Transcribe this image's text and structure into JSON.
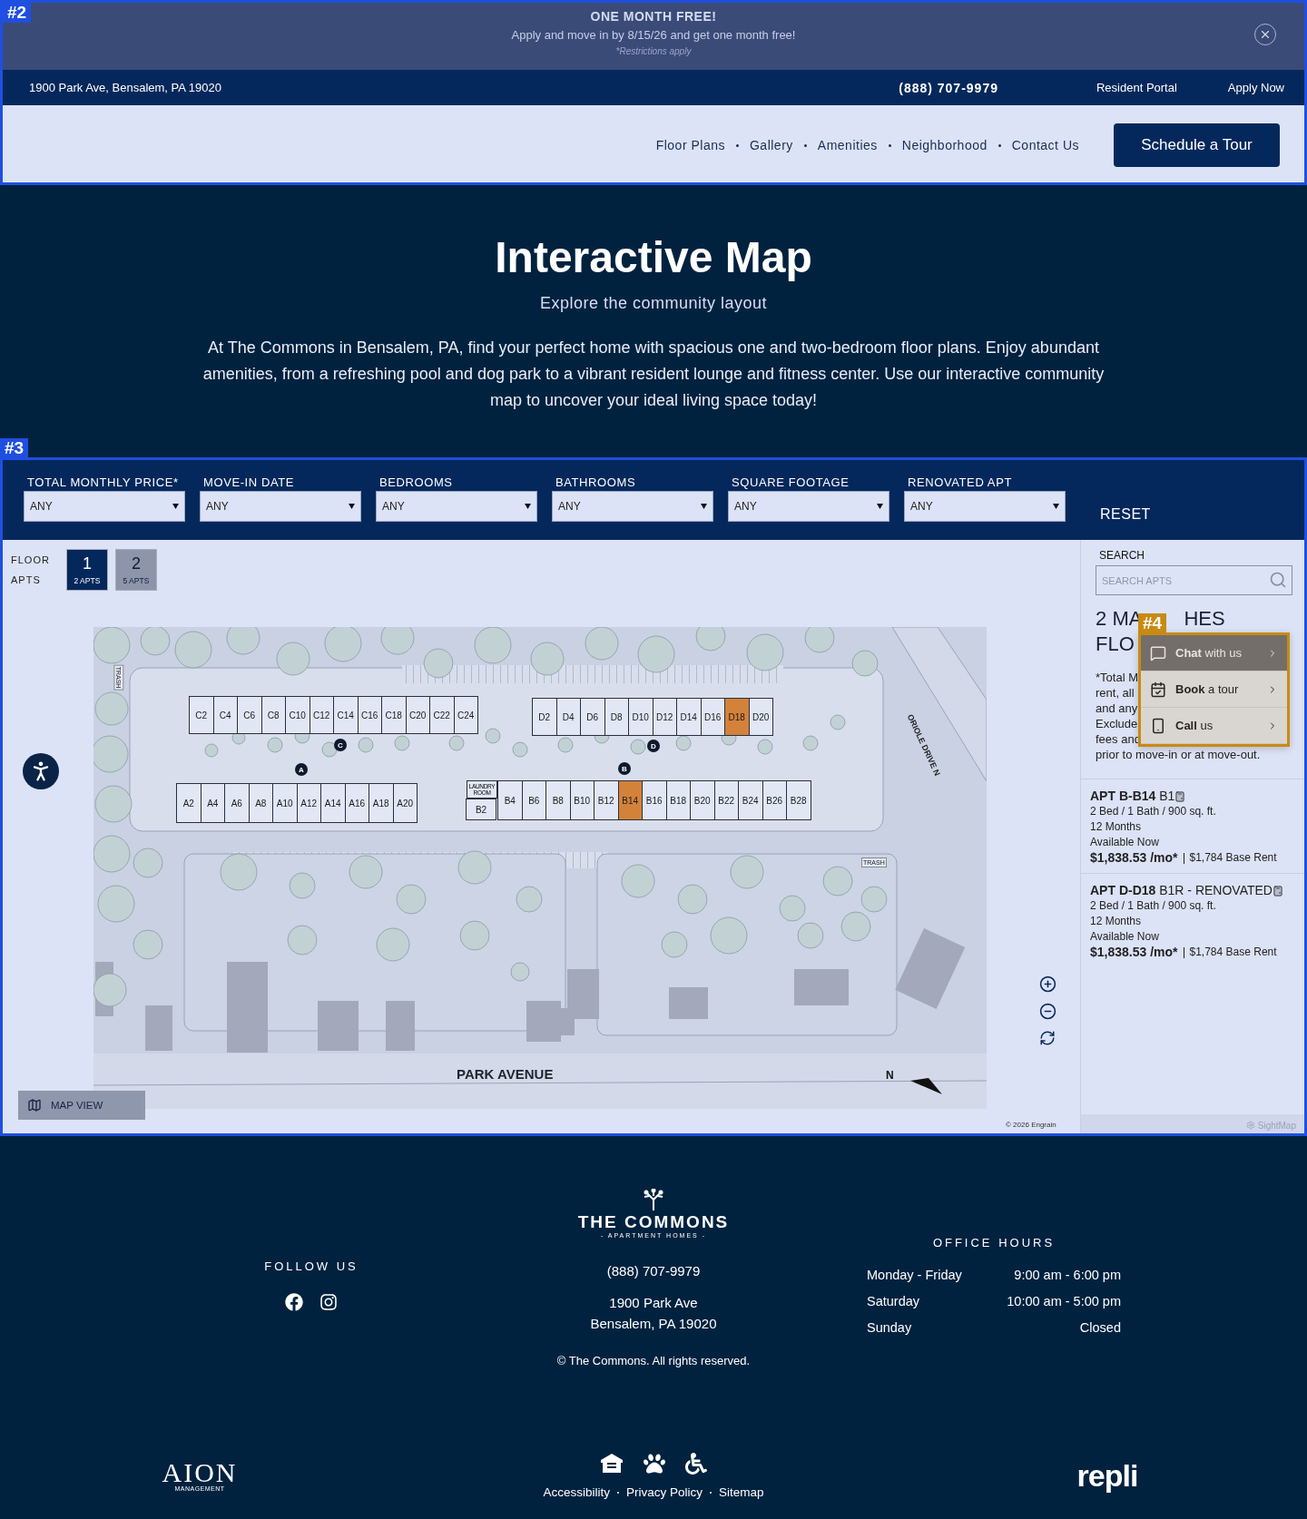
{
  "annotations": [
    {
      "label": "#2",
      "kind": "blue"
    },
    {
      "label": "#3",
      "kind": "blue"
    },
    {
      "label": "#4",
      "kind": "orange"
    }
  ],
  "promo": {
    "title": "ONE MONTH FREE!",
    "text": "Apply and move in by 8/15/26 and get one month free!",
    "note": "*Restrictions apply"
  },
  "topbar": {
    "address": "1900 Park Ave, Bensalem, PA 19020",
    "phone": "(888) 707-9979",
    "links": [
      "Resident Portal",
      "Apply Now"
    ]
  },
  "nav": {
    "items": [
      "Floor Plans",
      "Gallery",
      "Amenities",
      "Neighborhood",
      "Contact Us"
    ],
    "cta": "Schedule a Tour"
  },
  "hero": {
    "title": "Interactive Map",
    "subtitle": "Explore the community layout",
    "text": "At The Commons in Bensalem, PA, find your perfect home with spacious one and two-bedroom floor plans. Enjoy abundant amenities, from a refreshing pool and dog park to a vibrant resident lounge and fitness center. Use our interactive community map to uncover your ideal living space today!"
  },
  "filters": [
    {
      "label": "TOTAL MONTHLY PRICE*",
      "value": "ANY"
    },
    {
      "label": "MOVE-IN DATE",
      "value": "ANY"
    },
    {
      "label": "BEDROOMS",
      "value": "ANY"
    },
    {
      "label": "BATHROOMS",
      "value": "ANY"
    },
    {
      "label": "SQUARE FOOTAGE",
      "value": "ANY"
    },
    {
      "label": "RENOVATED APT",
      "value": "ANY"
    }
  ],
  "reset": "RESET",
  "floors": {
    "label_floor": "FLOOR",
    "label_apts": "APTS",
    "items": [
      {
        "number": "1",
        "count": "2 APTS",
        "selected": true
      },
      {
        "number": "2",
        "count": "5 APTS",
        "selected": false
      }
    ]
  },
  "map": {
    "buildings": [
      {
        "letter": "C",
        "units": [
          {
            "name": "C2",
            "highlighted": false
          },
          {
            "name": "C4",
            "highlighted": false
          },
          {
            "name": "C6",
            "highlighted": false
          },
          {
            "name": "C8",
            "highlighted": false
          },
          {
            "name": "C10",
            "highlighted": false
          },
          {
            "name": "C12",
            "highlighted": false
          },
          {
            "name": "C14",
            "highlighted": false
          },
          {
            "name": "C16",
            "highlighted": false
          },
          {
            "name": "C18",
            "highlighted": false
          },
          {
            "name": "C20",
            "highlighted": false
          },
          {
            "name": "C22",
            "highlighted": false
          },
          {
            "name": "C24",
            "highlighted": false
          }
        ]
      },
      {
        "letter": "D",
        "units": [
          {
            "name": "D2",
            "highlighted": false
          },
          {
            "name": "D4",
            "highlighted": false
          },
          {
            "name": "D6",
            "highlighted": false
          },
          {
            "name": "D8",
            "highlighted": false
          },
          {
            "name": "D10",
            "highlighted": false
          },
          {
            "name": "D12",
            "highlighted": false
          },
          {
            "name": "D14",
            "highlighted": false
          },
          {
            "name": "D16",
            "highlighted": false
          },
          {
            "name": "D18",
            "highlighted": true
          },
          {
            "name": "D20",
            "highlighted": false
          }
        ]
      },
      {
        "letter": "A",
        "units": [
          {
            "name": "A2",
            "highlighted": false
          },
          {
            "name": "A4",
            "highlighted": false
          },
          {
            "name": "A6",
            "highlighted": false
          },
          {
            "name": "A8",
            "highlighted": false
          },
          {
            "name": "A10",
            "highlighted": false
          },
          {
            "name": "A12",
            "highlighted": false
          },
          {
            "name": "A14",
            "highlighted": false
          },
          {
            "name": "A16",
            "highlighted": false
          },
          {
            "name": "A18",
            "highlighted": false
          },
          {
            "name": "A20",
            "highlighted": false
          }
        ]
      },
      {
        "letter": "B",
        "laundry": "LAUNDRY ROOM",
        "units": [
          {
            "name": "B2",
            "highlighted": false
          },
          {
            "name": "B4",
            "highlighted": false
          },
          {
            "name": "B6",
            "highlighted": false
          },
          {
            "name": "B8",
            "highlighted": false
          },
          {
            "name": "B10",
            "highlighted": false
          },
          {
            "name": "B12",
            "highlighted": false
          },
          {
            "name": "B14",
            "highlighted": true
          },
          {
            "name": "B16",
            "highlighted": false
          },
          {
            "name": "B18",
            "highlighted": false
          },
          {
            "name": "B20",
            "highlighted": false
          },
          {
            "name": "B22",
            "highlighted": false
          },
          {
            "name": "B24",
            "highlighted": false
          },
          {
            "name": "B26",
            "highlighted": false
          },
          {
            "name": "B28",
            "highlighted": false
          }
        ]
      }
    ],
    "trash_labels": [
      "TRASH",
      "TRASH"
    ],
    "street": "PARK AVENUE",
    "side_street": "ORIOLE DRIVE N",
    "compass": "N",
    "credit": "© 2026 Engrain",
    "view_button": "MAP VIEW",
    "brand": "SightMap"
  },
  "sidebar": {
    "search_label": "SEARCH",
    "placeholder": "SEARCH APTS",
    "count": "2",
    "heading": "MA",
    "heading_tail": "HES",
    "heading_line2": "FLO",
    "note_lines": [
      "*Total M",
      "rent, all",
      "and any",
      "Exclude",
      "fees and",
      "prior to move-in or at move-out."
    ],
    "listings": [
      {
        "apt": "APT B-B14",
        "plan": "B1",
        "details": "2 Bed / 1 Bath / 900 sq. ft.",
        "term": "12 Months",
        "availability": "Available Now",
        "price": "$1,838.53 /mo*",
        "base": "$1,784 Base Rent"
      },
      {
        "apt": "APT D-D18",
        "plan": "B1R - RENOVATED",
        "details": "2 Bed / 1 Bath / 900 sq. ft.",
        "term": "12 Months",
        "availability": "Available Now",
        "price": "$1,838.53 /mo*",
        "base": "$1,784 Base Rent"
      }
    ]
  },
  "chat": [
    {
      "kind": "chat",
      "text": "**Chat** with us",
      "selected": true
    },
    {
      "kind": "calendar",
      "text": "**Book** a tour",
      "selected": false
    },
    {
      "kind": "phone",
      "text": "**Call** us",
      "selected": false
    }
  ],
  "footer": {
    "follow": "FOLLOW US",
    "logo_name": "THE COMMONS",
    "logo_tagline": "- APARTMENT HOMES -",
    "phone": "(888) 707-9979",
    "address": [
      "1900 Park Ave",
      "Bensalem, PA 19020"
    ],
    "copyright": "© The Commons. All rights reserved.",
    "hours_title": "OFFICE HOURS",
    "hours": [
      {
        "day": "Monday - Friday",
        "time": "9:00 am - 6:00 pm"
      },
      {
        "day": "Saturday",
        "time": "10:00 am - 5:00 pm"
      },
      {
        "day": "Sunday",
        "time": "Closed"
      }
    ],
    "links": [
      "Accessibility",
      "Privacy Policy",
      "Sitemap"
    ],
    "brand_left": "AION",
    "brand_left_sub": "MANAGEMENT",
    "brand_right": "repli"
  }
}
